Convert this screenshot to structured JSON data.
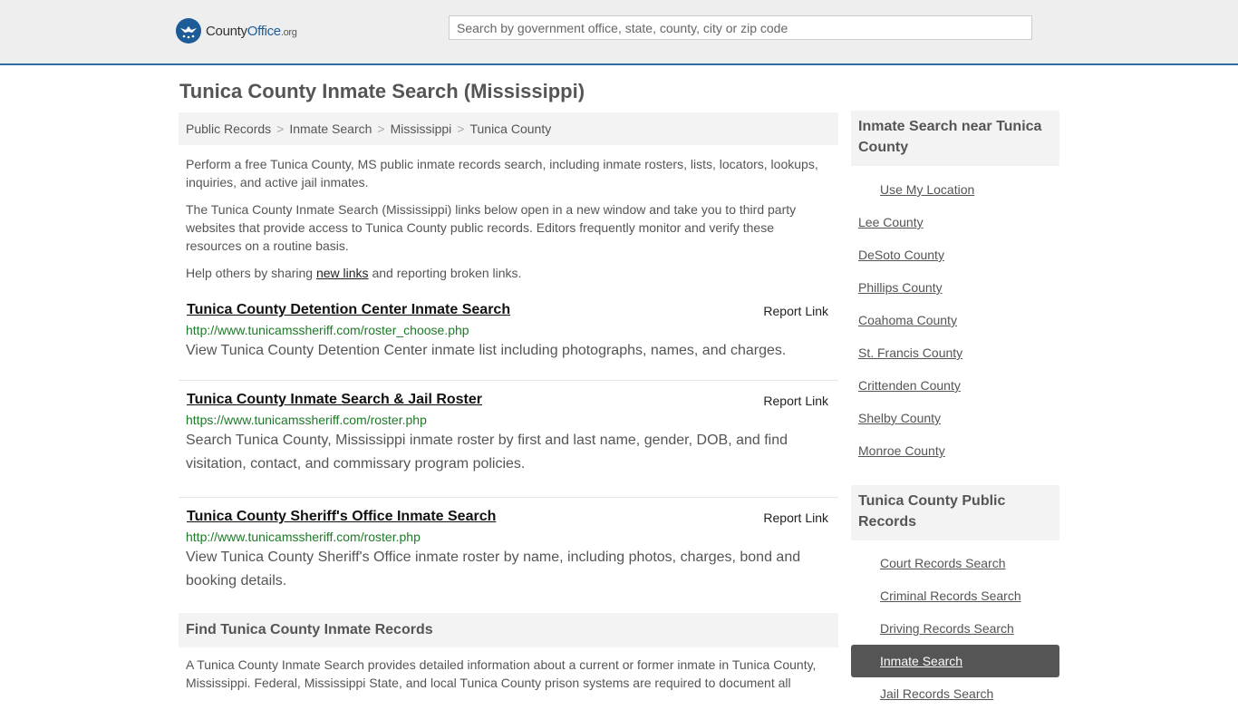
{
  "header": {
    "logo": {
      "county": "County",
      "office": "Office",
      "tld": ".org"
    },
    "search_placeholder": "Search by government office, state, county, city or zip code"
  },
  "page_title": "Tunica County Inmate Search (Mississippi)",
  "breadcrumb": [
    "Public Records",
    "Inmate Search",
    "Mississippi",
    "Tunica County"
  ],
  "breadcrumb_sep": ">",
  "intro": {
    "p1": "Perform a free Tunica County, MS public inmate records search, including inmate rosters, lists, locators, lookups, inquiries, and active jail inmates.",
    "p2": "The Tunica County Inmate Search (Mississippi) links below open in a new window and take you to third party websites that provide access to Tunica County public records. Editors frequently monitor and verify these resources on a routine basis.",
    "p3_before": "Help others by sharing ",
    "p3_link": "new links",
    "p3_after": " and reporting broken links."
  },
  "links": [
    {
      "title": "Tunica County Detention Center Inmate Search",
      "report": "Report Link",
      "url": "http://www.tunicamssheriff.com/roster_choose.php",
      "desc": "View Tunica County Detention Center inmate list including photographs, names, and charges."
    },
    {
      "title": "Tunica County Inmate Search & Jail Roster",
      "report": "Report Link",
      "url": "https://www.tunicamssheriff.com/roster.php",
      "desc": "Search Tunica County, Mississippi inmate roster by first and last name, gender, DOB, and find visitation, contact, and commissary program policies."
    },
    {
      "title": "Tunica County Sheriff's Office Inmate Search",
      "report": "Report Link",
      "url": "http://www.tunicamssheriff.com/roster.php",
      "desc": "View Tunica County Sheriff's Office inmate roster by name, including photos, charges, bond and booking details."
    }
  ],
  "find": {
    "heading": "Find Tunica County Inmate Records",
    "text": "A Tunica County Inmate Search provides detailed information about a current or former inmate in Tunica County, Mississippi. Federal, Mississippi State, and local Tunica County prison systems are required to document all"
  },
  "sidebar": {
    "nearby_heading": "Inmate Search near Tunica County",
    "nearby": [
      "Use My Location",
      "Lee County",
      "DeSoto County",
      "Phillips County",
      "Coahoma County",
      "St. Francis County",
      "Crittenden County",
      "Shelby County",
      "Monroe County"
    ],
    "records_heading": "Tunica County Public Records",
    "records": [
      "Court Records Search",
      "Criminal Records Search",
      "Driving Records Search",
      "Inmate Search",
      "Jail Records Search"
    ],
    "active_record": "Inmate Search"
  },
  "colors": {
    "brand": "#1e5c97",
    "url_green": "#1d7a28",
    "active_bg": "#555555"
  }
}
